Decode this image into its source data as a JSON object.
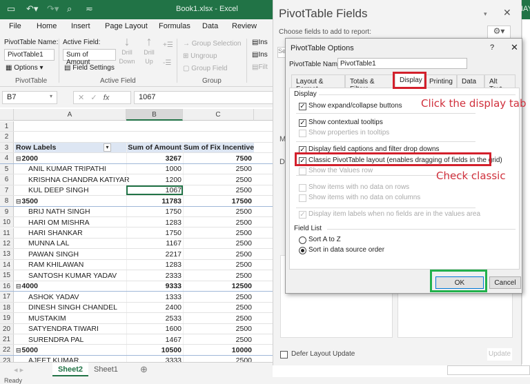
{
  "titlebar": {
    "title": "Book1.xlsx  -  Excel",
    "right_text": "IAY"
  },
  "menu": [
    "File",
    "Home",
    "Insert",
    "Page Layout",
    "Formulas",
    "Data",
    "Review"
  ],
  "ribbon": {
    "pivot_name_label": "PivotTable Name:",
    "pivot_name_value": "PivotTable1",
    "options_label": "Options",
    "group_pivottable": "PivotTable",
    "active_field_label": "Active Field:",
    "active_field_value": "Sum of Amount",
    "field_settings": "Field Settings",
    "drill_down": "Drill Down",
    "drill_up": "Drill Up",
    "group_active_field": "Active Field",
    "group_selection": "Group Selection",
    "ungroup": "Ungroup",
    "group_field": "Group Field",
    "group_group": "Group",
    "insert1": "Ins",
    "insert2": "Ins",
    "filter": "Filt"
  },
  "formula_bar": {
    "name_box": "B7",
    "fx": "fx",
    "value": "1067"
  },
  "columns": [
    "A",
    "B",
    "C"
  ],
  "pivot": {
    "header": [
      "Row Labels",
      "Sum of Amount",
      "Sum of Fix Incentive"
    ],
    "rows": [
      {
        "n": "4",
        "type": "group",
        "label": "2000",
        "amount": "3267",
        "incentive": "7500"
      },
      {
        "n": "5",
        "label": "ANIL KUMAR TRIPATHI",
        "amount": "1000",
        "incentive": "2500"
      },
      {
        "n": "6",
        "label": "KRISHNA CHANDRA KATIYAR",
        "amount": "1200",
        "incentive": "2500"
      },
      {
        "n": "7",
        "label": "KUL DEEP SINGH",
        "amount": "1067",
        "incentive": "2500"
      },
      {
        "n": "8",
        "type": "group",
        "label": "3500",
        "amount": "11783",
        "incentive": "17500"
      },
      {
        "n": "9",
        "label": "BRIJ NATH SINGH",
        "amount": "1750",
        "incentive": "2500"
      },
      {
        "n": "10",
        "label": "HARI OM MISHRA",
        "amount": "1283",
        "incentive": "2500"
      },
      {
        "n": "11",
        "label": "HARI SHANKAR",
        "amount": "1750",
        "incentive": "2500"
      },
      {
        "n": "12",
        "label": "MUNNA LAL",
        "amount": "1167",
        "incentive": "2500"
      },
      {
        "n": "13",
        "label": "PAWAN SINGH",
        "amount": "2217",
        "incentive": "2500"
      },
      {
        "n": "14",
        "label": "RAM KHILAWAN",
        "amount": "1283",
        "incentive": "2500"
      },
      {
        "n": "15",
        "label": "SANTOSH KUMAR YADAV",
        "amount": "2333",
        "incentive": "2500"
      },
      {
        "n": "16",
        "type": "group",
        "label": "4000",
        "amount": "9333",
        "incentive": "12500"
      },
      {
        "n": "17",
        "label": "ASHOK YADAV",
        "amount": "1333",
        "incentive": "2500"
      },
      {
        "n": "18",
        "label": "DINESH SINGH CHANDEL",
        "amount": "2400",
        "incentive": "2500"
      },
      {
        "n": "19",
        "label": "MUSTAKIM",
        "amount": "2533",
        "incentive": "2500"
      },
      {
        "n": "20",
        "label": "SATYENDRA TIWARI",
        "amount": "1600",
        "incentive": "2500"
      },
      {
        "n": "21",
        "label": "SURENDRA PAL",
        "amount": "1467",
        "incentive": "2500"
      },
      {
        "n": "22",
        "type": "group",
        "label": "5000",
        "amount": "10500",
        "incentive": "10000"
      },
      {
        "n": "23",
        "label": "AJEET KUMAR",
        "amount": "3333",
        "incentive": "2500"
      }
    ]
  },
  "sheet_tabs": [
    "Sheet2",
    "Sheet1"
  ],
  "status": "Ready",
  "fields_pane": {
    "title": "PivotTable Fields",
    "choose": "Choose fields to add to report:",
    "search_stub": "Se",
    "m_stub": "M",
    "d_stub": "D",
    "defer": "Defer Layout Update",
    "update": "Update"
  },
  "dialog": {
    "title": "PivotTable Options",
    "help": "?",
    "name_label": "PivotTable Name:",
    "name_value": "PivotTable1",
    "tabs": [
      "Layout & Format",
      "Totals & Filters",
      "Display",
      "Printing",
      "Data",
      "Alt Text"
    ],
    "active_tab": "Display",
    "display_section": "Display",
    "options": [
      {
        "label": "Show expand/collapse buttons",
        "checked": true,
        "enabled": true
      },
      {
        "label": "Show contextual tooltips",
        "checked": true,
        "enabled": true
      },
      {
        "label": "Show properties in tooltips",
        "checked": false,
        "enabled": false
      },
      {
        "label": "Display field captions and filter drop downs",
        "checked": true,
        "enabled": true
      },
      {
        "label": "Classic PivotTable layout (enables dragging of fields in the grid)",
        "checked": true,
        "enabled": true
      },
      {
        "label": "Show the Values row",
        "checked": false,
        "enabled": false
      },
      {
        "label": "Show items with no data on rows",
        "checked": false,
        "enabled": false
      },
      {
        "label": "Show items with no data on columns",
        "checked": false,
        "enabled": false
      },
      {
        "label": "Display item labels when no fields are in the values area",
        "checked": true,
        "enabled": false
      }
    ],
    "field_list_section": "Field List",
    "sort_az": "Sort A to Z",
    "sort_source": "Sort in data source order",
    "sort_selected": "source",
    "ok": "OK",
    "cancel": "Cancel"
  },
  "annotations": {
    "display_tab": "Click the display tab",
    "classic": "Check classic",
    "color": "#d0303c",
    "ok_highlight": "#22b14c"
  }
}
